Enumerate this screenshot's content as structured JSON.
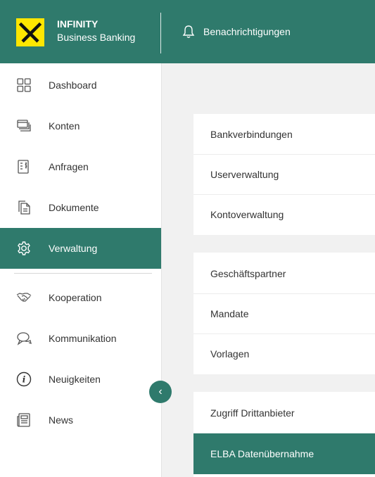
{
  "brand": {
    "line1": "INFINITY",
    "line2": "Business Banking"
  },
  "header": {
    "notifications_label": "Benachrichtigungen"
  },
  "colors": {
    "primary": "#2f7a6c",
    "logo_yellow": "#ffe600"
  },
  "sidebar": {
    "items": [
      {
        "label": "Dashboard",
        "icon": "dashboard-grid-icon"
      },
      {
        "label": "Konten",
        "icon": "cards-stack-icon"
      },
      {
        "label": "Anfragen",
        "icon": "request-form-icon"
      },
      {
        "label": "Dokumente",
        "icon": "documents-icon"
      },
      {
        "label": "Verwaltung",
        "icon": "gear-icon",
        "active": true
      },
      {
        "label": "Kooperation",
        "icon": "handshake-icon"
      },
      {
        "label": "Kommunikation",
        "icon": "chat-bubbles-icon"
      },
      {
        "label": "Neuigkeiten",
        "icon": "info-icon"
      },
      {
        "label": "News",
        "icon": "newspaper-icon"
      }
    ]
  },
  "main": {
    "groups": [
      {
        "items": [
          "Bankverbindungen",
          "Userverwaltung",
          "Kontoverwaltung"
        ]
      },
      {
        "items": [
          "Geschäftspartner",
          "Mandate",
          "Vorlagen"
        ]
      },
      {
        "items": [
          "Zugriff Drittanbieter",
          "ELBA Datenübernahme"
        ],
        "active_item": "ELBA Datenübernahme"
      }
    ]
  }
}
